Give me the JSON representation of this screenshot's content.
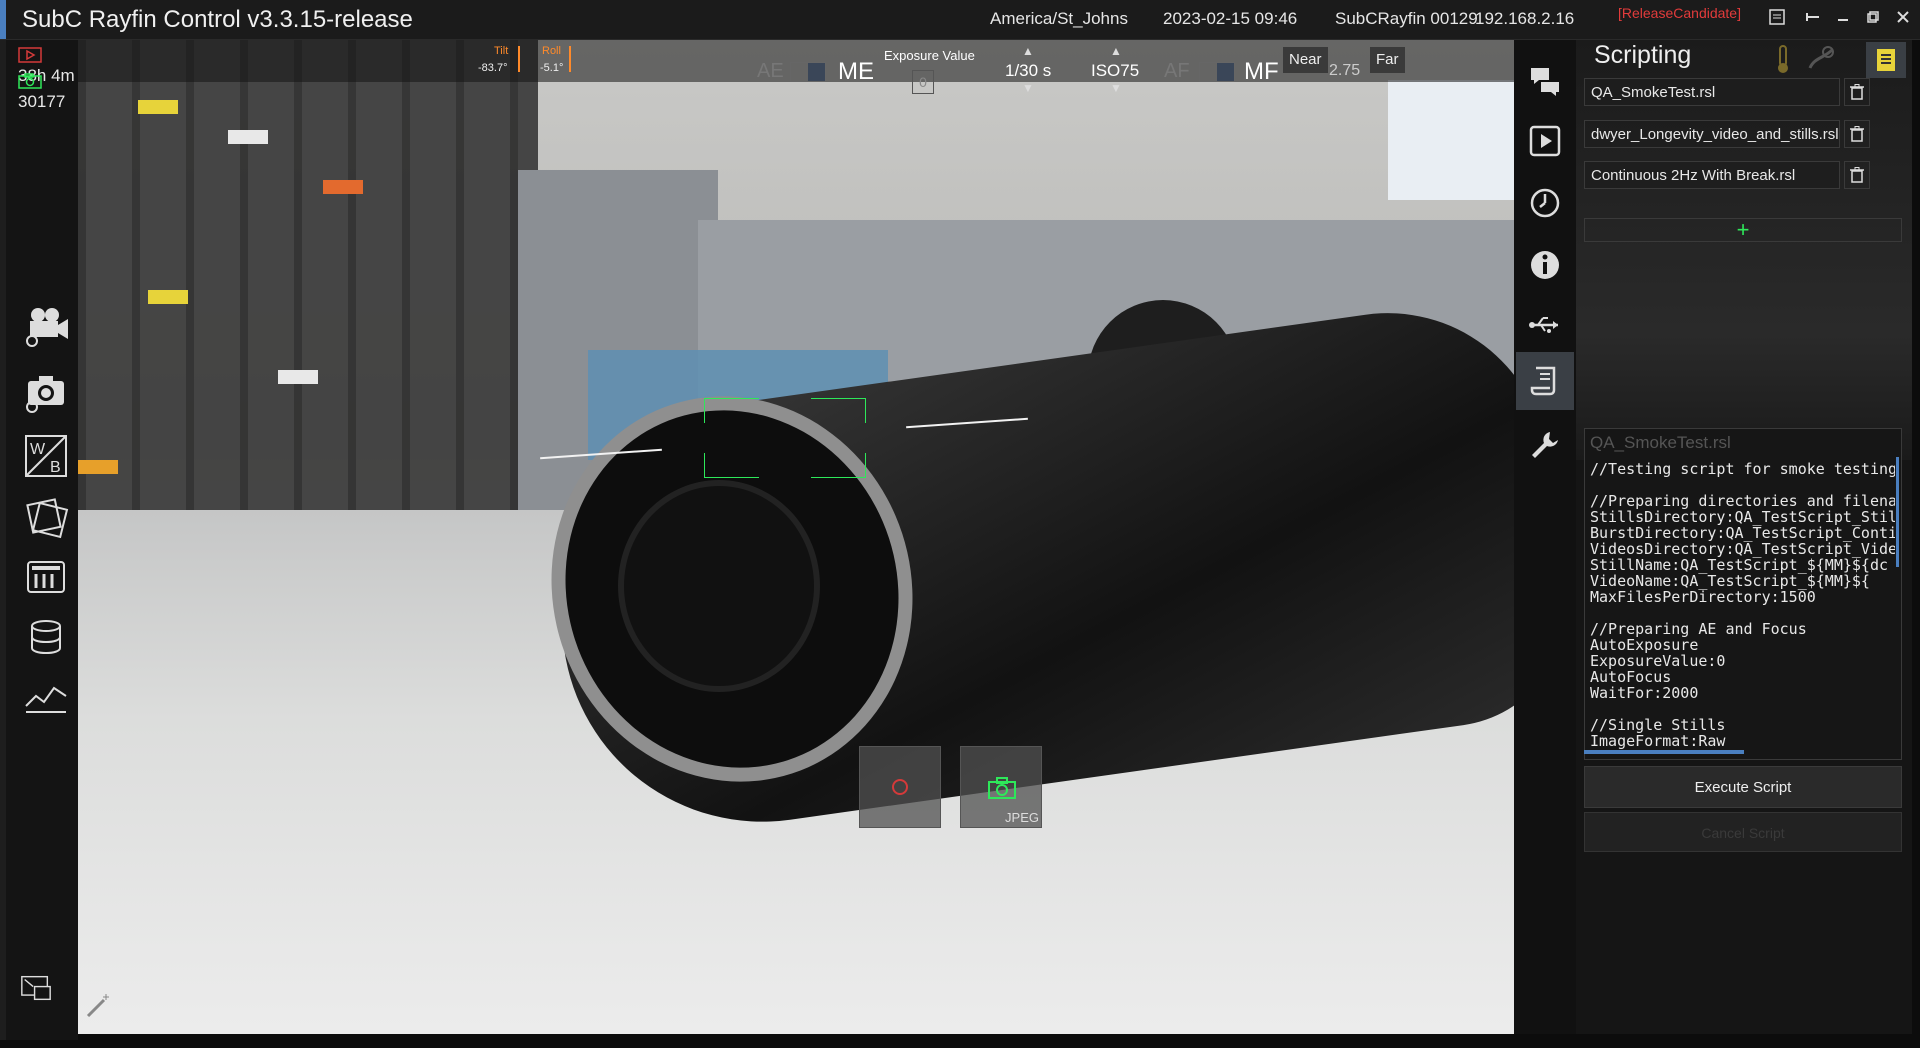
{
  "titlebar": {
    "app_title": "SubC Rayfin Control v3.3.15-release",
    "timezone": "America/St_Johns",
    "datetime": "2023-02-15 09:46",
    "device_name": "SubCRayfin 00129",
    "ip_address": "192.168.2.16",
    "release_tag": "[ReleaseCandidate]"
  },
  "stats": {
    "recording_time": "38h 4m",
    "photo_count": "30177"
  },
  "camera_controls": {
    "tilt_label": "Tilt",
    "tilt_value": "-83.7°",
    "roll_label": "Roll",
    "roll_value": "-5.1°",
    "ae_label": "AE",
    "me_label": "ME",
    "exposure_value_label": "Exposure Value",
    "exposure_value": "0",
    "shutter": "1/30 s",
    "iso": "ISO75",
    "af_label": "AF",
    "mf_label": "MF",
    "near_label": "Near",
    "focus_value": "2.75",
    "far_label": "Far"
  },
  "capture": {
    "format_label": "JPEG"
  },
  "scripting": {
    "title": "Scripting",
    "scripts": [
      {
        "name": "QA_SmokeTest.rsl"
      },
      {
        "name": "dwyer_Longevity_video_and_stills.rsl"
      },
      {
        "name": "Continuous 2Hz With Break.rsl"
      }
    ],
    "add_label": "+",
    "editor_title": "QA_SmokeTest.rsl",
    "editor_code": "//Testing script for smoke testing ma\n\n//Preparing directories and filenames\nStillsDirectory:QA_TestScript_Stills_$\nBurstDirectory:QA_TestScript_Contin\nVideosDirectory:QA_TestScript_Videc\nStillName:QA_TestScript_${MM}${dc\nVideoName:QA_TestScript_${MM}${\nMaxFilesPerDirectory:1500\n\n//Preparing AE and Focus\nAutoExposure\nExposureValue:0\nAutoFocus\nWaitFor:2000\n\n//Single Stills\nImageFormat:Raw",
    "execute_label": "Execute Script",
    "cancel_label": "Cancel Script"
  },
  "colors": {
    "accent_blue": "#4a7fc0",
    "focus_green": "#2ee85a",
    "warning_red": "#e23b3b",
    "tilt_orange": "#ff8a2a"
  }
}
